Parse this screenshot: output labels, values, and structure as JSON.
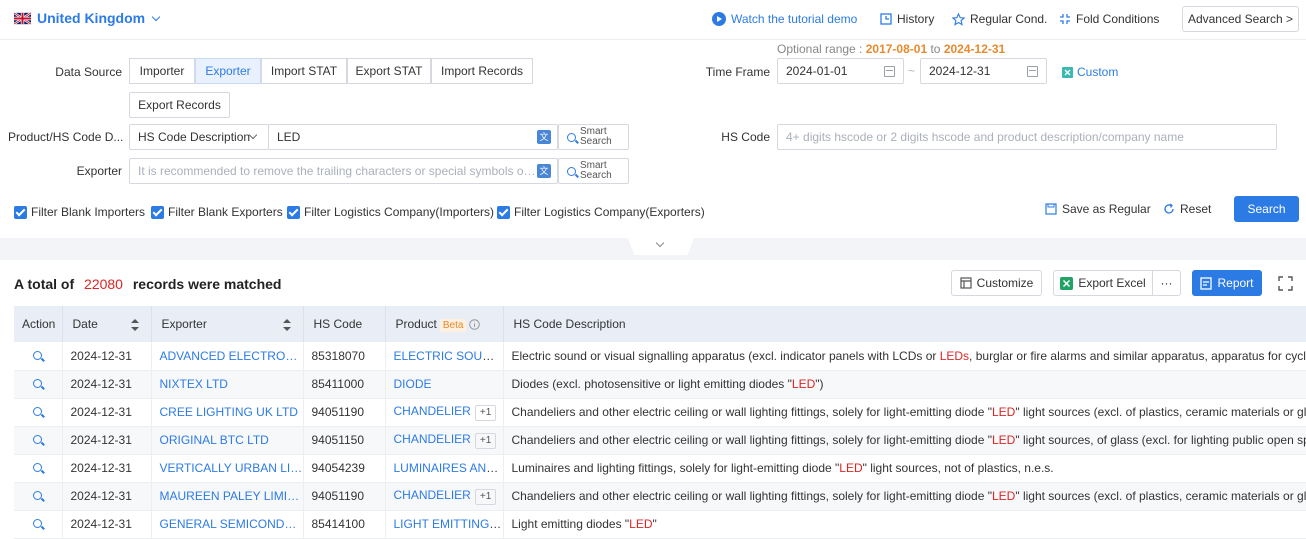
{
  "header": {
    "country": "United Kingdom",
    "tutorial": "Watch the tutorial demo",
    "history": "History",
    "regular": "Regular Cond.",
    "fold": "Fold Conditions",
    "advanced": "Advanced Search >"
  },
  "form": {
    "data_source_label": "Data Source",
    "data_sources": [
      "Importer",
      "Exporter",
      "Import STAT",
      "Export STAT",
      "Import Records",
      "Export Records"
    ],
    "active_source": "Exporter",
    "optional_range_label": "Optional range :",
    "optional_range_from": "2017-08-01",
    "optional_range_to_word": "to",
    "optional_range_to": "2024-12-31",
    "time_frame_label": "Time Frame",
    "date_start": "2024-01-01",
    "date_sep": "~",
    "date_end": "2024-12-31",
    "custom": "Custom",
    "product_label": "Product/HS Code D...",
    "product_type": "HS Code Description",
    "product_value": "LED",
    "smart_search": [
      "Smart",
      "Search"
    ],
    "hs_code_label": "HS Code",
    "hs_code_placeholder": "4+ digits hscode or 2 digits hscode and product description/company name",
    "exporter_label": "Exporter",
    "exporter_placeholder": "It is recommended to remove the trailing characters or special symbols of the...",
    "filters": [
      "Filter Blank Importers",
      "Filter Blank Exporters",
      "Filter Logistics Company(Importers)",
      "Filter Logistics Company(Exporters)"
    ],
    "save_regular": "Save as Regular",
    "reset": "Reset",
    "search": "Search"
  },
  "results": {
    "prefix": "A total of",
    "count": "22080",
    "suffix": "records were matched",
    "customize": "Customize",
    "export_excel": "Export Excel",
    "more": "···",
    "report": "Report"
  },
  "table": {
    "headers": [
      "Action",
      "Date",
      "Exporter",
      "HS Code",
      "Product",
      "HS Code Description"
    ],
    "beta": "Beta",
    "rows": [
      {
        "date": "2024-12-31",
        "exporter": "ADVANCED ELECTRONIC...",
        "hs": "85318070",
        "product": "ELECTRIC SOUND...",
        "extra": "",
        "desc_pre": "Electric sound or visual signalling apparatus (excl. indicator panels with LCDs or ",
        "desc_red": "LEDs",
        "desc_post": ", burglar or fire alarms and similar apparatus, apparatus for cycles, mot"
      },
      {
        "date": "2024-12-31",
        "exporter": "NIXTEX LTD",
        "hs": "85411000",
        "product": "DIODE",
        "extra": "",
        "desc_pre": "Diodes (excl. photosensitive or light emitting diodes \"",
        "desc_red": "LED",
        "desc_post": "\")"
      },
      {
        "date": "2024-12-31",
        "exporter": "CREE LIGHTING UK LTD",
        "hs": "94051190",
        "product": "CHANDELIER",
        "extra": "+1",
        "desc_pre": "Chandeliers and other electric ceiling or wall lighting fittings, solely for light-emitting diode \"",
        "desc_red": "LED",
        "desc_post": "\" light sources (excl. of plastics, ceramic materials or glass, a"
      },
      {
        "date": "2024-12-31",
        "exporter": "ORIGINAL BTC LTD",
        "hs": "94051150",
        "product": "CHANDELIER",
        "extra": "+1",
        "desc_pre": "Chandeliers and other electric ceiling or wall lighting fittings, solely for light-emitting diode \"",
        "desc_red": "LED",
        "desc_post": "\" light sources, of glass (excl. for lighting public open spaces"
      },
      {
        "date": "2024-12-31",
        "exporter": "VERTICALLY URBAN LIMI...",
        "hs": "94054239",
        "product": "LUMINAIRES AND...",
        "extra": "",
        "desc_pre": "Luminaires and lighting fittings, solely for light-emitting diode \"",
        "desc_red": "LED",
        "desc_post": "\" light sources, not of plastics, n.e.s."
      },
      {
        "date": "2024-12-31",
        "exporter": "MAUREEN PALEY LIMITED",
        "hs": "94051190",
        "product": "CHANDELIER",
        "extra": "+1",
        "desc_pre": "Chandeliers and other electric ceiling or wall lighting fittings, solely for light-emitting diode \"",
        "desc_red": "LED",
        "desc_post": "\" light sources (excl. of plastics, ceramic materials or glass, a"
      },
      {
        "date": "2024-12-31",
        "exporter": "GENERAL SEMICONDUC...",
        "hs": "85414100",
        "product": "LIGHT EMITTING ...",
        "extra": "",
        "desc_pre": "Light emitting diodes \"",
        "desc_red": "LED",
        "desc_post": "\""
      }
    ]
  },
  "colors": {
    "accent": "#2c7be5",
    "orange": "#e88a2d",
    "red": "#e02424"
  }
}
